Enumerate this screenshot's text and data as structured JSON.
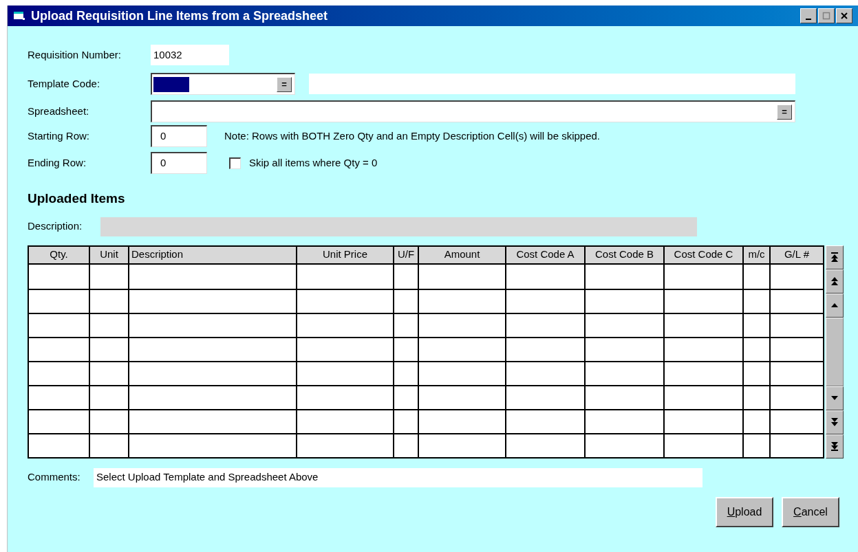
{
  "window": {
    "title": "Upload Requisition Line Items from a Spreadsheet"
  },
  "form": {
    "requisition_number": {
      "label": "Requisition Number:",
      "value": "10032"
    },
    "template_code": {
      "label": "Template Code:",
      "button": "=",
      "highlighted": true
    },
    "spreadsheet": {
      "label": "Spreadsheet:",
      "button": "="
    },
    "starting_row": {
      "label": "Starting Row:",
      "value": "0"
    },
    "note": "Note: Rows with BOTH Zero Qty and an Empty Description Cell(s) will be skipped.",
    "ending_row": {
      "label": "Ending Row:",
      "value": "0"
    },
    "skip_zero_qty": {
      "label": "Skip all items where Qty = 0",
      "checked": false
    }
  },
  "uploaded_items": {
    "heading": "Uploaded Items",
    "description_label": "Description:",
    "table": {
      "columns": [
        {
          "label": "Qty."
        },
        {
          "label": "Unit"
        },
        {
          "label": "Description"
        },
        {
          "label": "Unit Price"
        },
        {
          "label": "U/F"
        },
        {
          "label": "Amount"
        },
        {
          "label": "Cost Code A"
        },
        {
          "label": "Cost Code B"
        },
        {
          "label": "Cost Code C"
        },
        {
          "label": "m/c"
        },
        {
          "label": "G/L #"
        }
      ]
    }
  },
  "comments": {
    "label": "Comments:",
    "value": "Select Upload Template and Spreadsheet Above"
  },
  "buttons": [
    {
      "label": "Upload"
    },
    {
      "label": "Cancel"
    }
  ]
}
